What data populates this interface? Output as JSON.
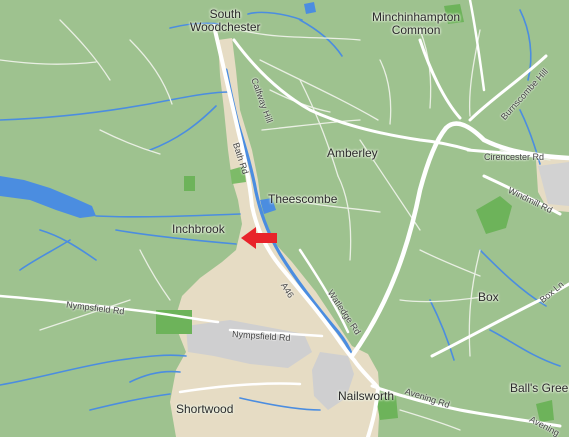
{
  "map": {
    "places": {
      "south_woodchester_line1": "South",
      "south_woodchester_line2": "Woodchester",
      "minchinhampton_line1": "Minchinhampton",
      "minchinhampton_line2": "Common",
      "amberley": "Amberley",
      "theescombe": "Theescombe",
      "inchbrook": "Inchbrook",
      "box": "Box",
      "balls_green": "Ball's Green",
      "nailsworth": "Nailsworth",
      "shortwood": "Shortwood"
    },
    "roads": {
      "calfway_hill": "Calfway Hill",
      "bath_rd": "Bath Rd",
      "burnscombe_hill": "Burnscombe Hill",
      "cirencester_rd": "Cirencester Rd",
      "windmill_rd": "Windmill Rd",
      "a46": "A46",
      "watledge_rd": "Watledge Rd",
      "nympsfield_rd_west": "Nympsfield Rd",
      "nympsfield_rd_east": "Nympsfield Rd",
      "box_ln": "Box Ln",
      "avening_rd": "Avening Rd",
      "avening_rd_east": "Avening"
    },
    "marker": {
      "icon": "red-arrow-left-icon",
      "color": "#e8232a"
    },
    "colors": {
      "land": "#9ec28f",
      "urban": "#e6dcc4",
      "water": "#4b8de0",
      "park": "#6db35a",
      "road": "#ffffff"
    }
  }
}
